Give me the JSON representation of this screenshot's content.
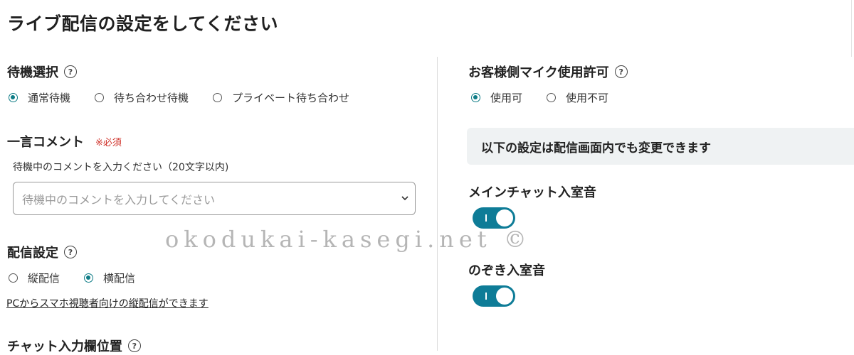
{
  "page_title": "ライブ配信の設定をしてください",
  "left": {
    "standby": {
      "heading": "待機選択",
      "options": [
        {
          "label": "通常待機",
          "selected": true
        },
        {
          "label": "待ち合わせ待機",
          "selected": false
        },
        {
          "label": "プライベート待ち合わせ",
          "selected": false
        }
      ]
    },
    "comment": {
      "heading": "一言コメント",
      "required": "※必須",
      "hint": "待機中のコメントを入力ください（20文字以内)",
      "placeholder": "待機中のコメントを入力してください"
    },
    "broadcast": {
      "heading": "配信設定",
      "options": [
        {
          "label": "縦配信",
          "selected": false
        },
        {
          "label": "横配信",
          "selected": true
        }
      ],
      "link": "PCからスマホ視聴者向けの縦配信ができます"
    },
    "chat_position": {
      "heading": "チャット入力欄位置"
    }
  },
  "right": {
    "mic": {
      "heading": "お客様側マイク使用許可",
      "options": [
        {
          "label": "使用可",
          "selected": true
        },
        {
          "label": "使用不可",
          "selected": false
        }
      ]
    },
    "info": "以下の設定は配信画面内でも変更できます",
    "main_chat_sound": {
      "heading": "メインチャット入室音",
      "on": true
    },
    "peek_sound": {
      "heading": "のぞき入室音",
      "on": true
    }
  },
  "watermark": "okodukai-kasegi.net ©",
  "colors": {
    "accent": "#0e7c86",
    "toggle": "#0e7c97",
    "required": "#d0342c"
  }
}
